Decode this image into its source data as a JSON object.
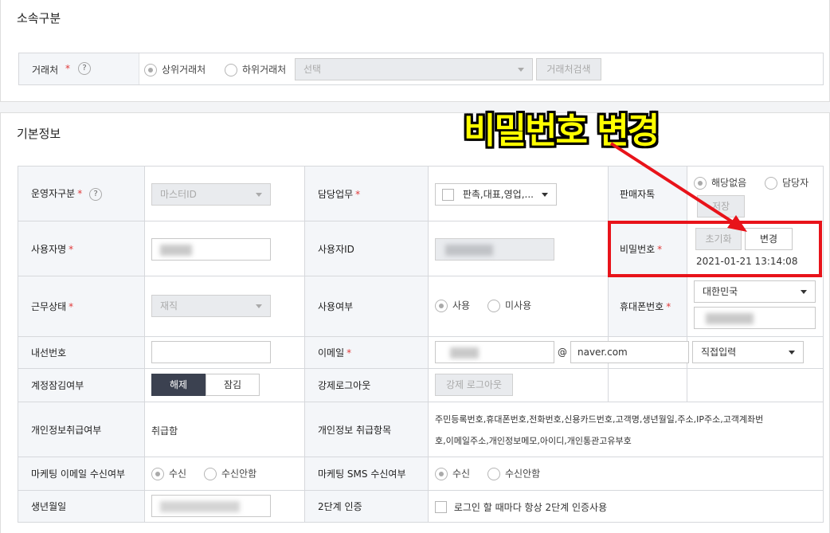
{
  "sections": {
    "affiliation_title": "소속구분",
    "basic_title": "기본정보"
  },
  "affiliation": {
    "label": "거래처",
    "radio_upper": "상위거래처",
    "radio_lower": "하위거래처",
    "select_placeholder": "선택",
    "search_button": "거래처검색"
  },
  "form": {
    "operator_type": {
      "label": "운영자구분",
      "value": "마스터ID"
    },
    "duty": {
      "label": "담당업무",
      "value": "판촉,대표,영업,..."
    },
    "sales_talk": {
      "label": "판매자톡",
      "opt_none": "해당없음",
      "opt_manager": "담당자",
      "save_button": "저장"
    },
    "user_name": {
      "label": "사용자명"
    },
    "user_id": {
      "label": "사용자ID"
    },
    "password": {
      "label": "비밀번호",
      "reset_button": "초기화",
      "change_button": "변경",
      "timestamp": "2021-01-21 13:14:08"
    },
    "work_status": {
      "label": "근무상태",
      "value": "재직"
    },
    "use_status": {
      "label": "사용여부",
      "opt_use": "사용",
      "opt_unused": "미사용"
    },
    "mobile": {
      "label": "휴대폰번호",
      "country": "대한민국"
    },
    "extension": {
      "label": "내선번호"
    },
    "email": {
      "label": "이메일",
      "at": "@",
      "domain": "naver.com",
      "domain_select": "직접입력"
    },
    "account_lock": {
      "label": "계정잠김여부",
      "unlock": "해제",
      "lock": "잠김"
    },
    "force_logout": {
      "label": "강제로그아웃",
      "button": "강제 로그아웃"
    },
    "privacy_handling": {
      "label": "개인정보취급여부",
      "value": "취급함"
    },
    "privacy_items": {
      "label": "개인정보 취급항목",
      "line1": "주민등록번호,휴대폰번호,전화번호,신용카드번호,고객명,생년월일,주소,IP주소,고객계좌번",
      "line2": "호,이메일주소,개인정보메모,아이디,개인통관고유부호"
    },
    "marketing_email": {
      "label": "마케팅 이메일 수신여부",
      "opt_receive": "수신",
      "opt_reject": "수신안함"
    },
    "marketing_sms": {
      "label": "마케팅 SMS 수신여부",
      "opt_receive": "수신",
      "opt_reject": "수신안함"
    },
    "birthday": {
      "label": "생년월일"
    },
    "two_factor": {
      "label": "2단계 인증",
      "text": "로그인 할 때마다 항상 2단계 인증사용"
    }
  },
  "annotation": {
    "text": "비밀번호 변경",
    "text_color": "#ffff00",
    "highlight_color": "#e8131a"
  }
}
